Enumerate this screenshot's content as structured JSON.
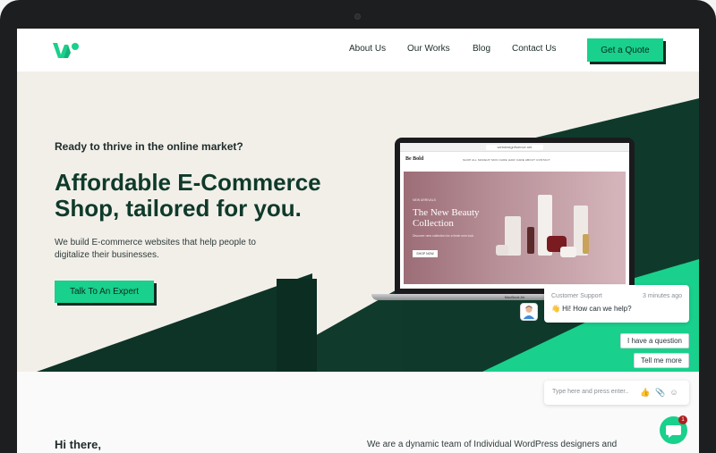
{
  "nav": {
    "links": [
      "About Us",
      "Our Works",
      "Blog",
      "Contact Us"
    ],
    "cta": "Get a Quote"
  },
  "hero": {
    "eyebrow": "Ready to thrive in the online market?",
    "title": "Affordable E-Commerce Shop, tailored for you.",
    "description": "We build E-commerce websites that help people to digitalize their businesses.",
    "cta": "Talk To An Expert"
  },
  "mockup": {
    "url": "webdesignfluence.net",
    "brand": "Be Bold",
    "menu": "SHOP ALL   MAKEUP   SKIN CARE   HAIR CARE   ABOUT   CONTACT",
    "kicker": "NEW ARRIVALS",
    "headline": "The New Beauty Collection",
    "body": "Discover new collection for a fresh new look",
    "button": "SHOP NOW",
    "device_label": "MacBook Air"
  },
  "chat": {
    "agent": "Customer Support",
    "time": "3 minutes ago",
    "message": "👋 Hi! How can we help?",
    "replies": [
      "I have a question",
      "Tell me more"
    ],
    "input_placeholder": "Type here and press enter..",
    "badge": "1"
  },
  "intro": {
    "greeting": "Hi there,",
    "text": "We are a dynamic team of Individual WordPress designers and"
  },
  "colors": {
    "accent": "#19d08c",
    "dark_green": "#0f3a2b",
    "hero_bg": "#f2efe9"
  }
}
